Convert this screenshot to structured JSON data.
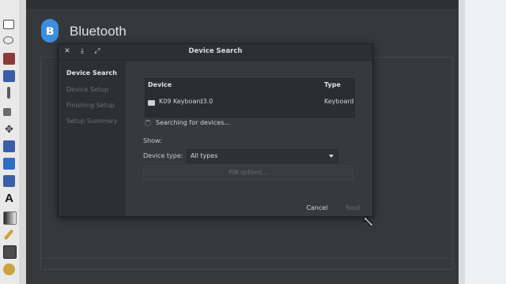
{
  "settings": {
    "title": "Bluetooth"
  },
  "dialog": {
    "title": "Device Search",
    "header_buttons": [
      "close-icon",
      "minimize-icon",
      "maximize-icon"
    ],
    "steps": [
      {
        "label": "Device Search",
        "active": true
      },
      {
        "label": "Device Setup",
        "active": false
      },
      {
        "label": "Finishing Setup",
        "active": false
      },
      {
        "label": "Setup Summary",
        "active": false
      }
    ],
    "table": {
      "columns": [
        "Device",
        "Type"
      ],
      "rows": [
        {
          "device": "K09 Keyboard3.0",
          "type": "Keyboard",
          "icon": "keyboard-icon"
        }
      ]
    },
    "status": "Searching for devices...",
    "show_label": "Show:",
    "device_type_label": "Device type:",
    "device_type_value": "All types",
    "pin_button": "PIN options...",
    "cancel": "Cancel",
    "next": "Next"
  },
  "colors": {
    "accent": "#3d8ee0",
    "window_bg": "#36393c",
    "dialog_bg": "#2d3033"
  }
}
